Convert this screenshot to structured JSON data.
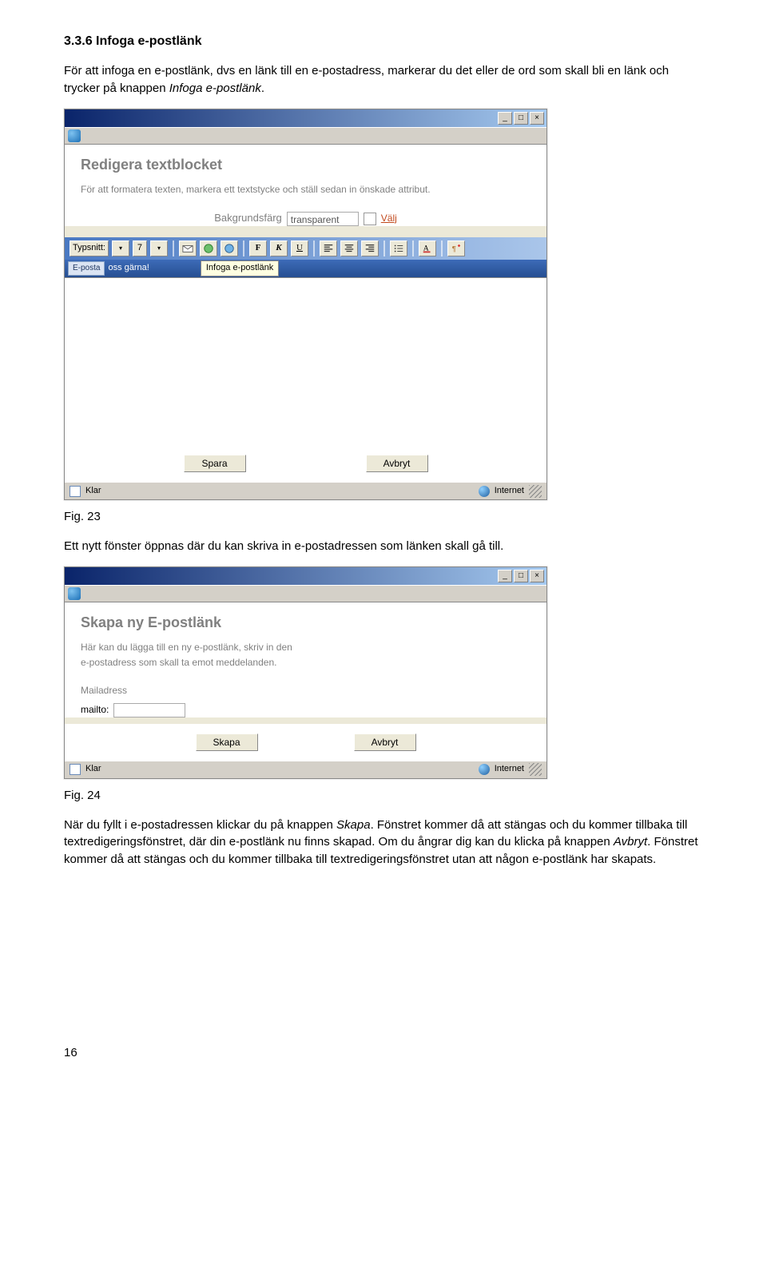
{
  "heading": "3.3.6 Infoga e-postlänk",
  "p1a": "För att infoga en e-postlänk, dvs en länk till en e-postadress, markerar du det eller de ord som skall bli en länk och trycker på knappen ",
  "p1b": "Infoga e-postlänk",
  "p1c": ".",
  "fig23": "Fig. 23",
  "p2": "Ett nytt fönster öppnas där du kan skriva in e-postadressen som länken skall gå till.",
  "fig24": "Fig. 24",
  "p3a": "När du fyllt i e-postadressen klickar du på knappen ",
  "p3b": "Skapa",
  "p3c": ". Fönstret kommer då att stängas och du kommer tillbaka till textredigeringsfönstret, där din e-postlänk nu finns skapad. Om du ångrar dig kan du klicka på knappen ",
  "p3d": "Avbryt",
  "p3e": ". Fönstret kommer då att stängas och du kommer tillbaka till textredigeringsfönstret utan att någon e-postlänk har skapats.",
  "pagenum": "16",
  "win1": {
    "min": "_",
    "max": "□",
    "close": "×",
    "panelTitle": "Redigera textblocket",
    "panelSub": "För att formatera texten, markera ett textstycke och ställ sedan in önskade attribut.",
    "bgLabel": "Bakgrundsfärg",
    "bgValue": "transparent",
    "valjLink": "Välj",
    "fontLabel": "Typsnitt:",
    "fontSize": "7",
    "F": "F",
    "K": "K",
    "U": "U",
    "eposta": "E-posta",
    "ossGarna": " oss gärna!",
    "tooltip": "Infoga e-postlänk",
    "spara": "Spara",
    "avbryt": "Avbryt",
    "statusLeft": "Klar",
    "statusRight": "Internet"
  },
  "win2": {
    "min": "_",
    "max": "□",
    "close": "×",
    "panelTitle": "Skapa ny E-postlänk",
    "panelSubL1": "Här kan du lägga till en ny e-postlänk, skriv in den",
    "panelSubL2": "e-postadress som skall ta emot meddelanden.",
    "mailadress": "Mailadress",
    "mailto": "mailto:",
    "skapa": "Skapa",
    "avbryt": "Avbryt",
    "statusLeft": "Klar",
    "statusRight": "Internet"
  }
}
